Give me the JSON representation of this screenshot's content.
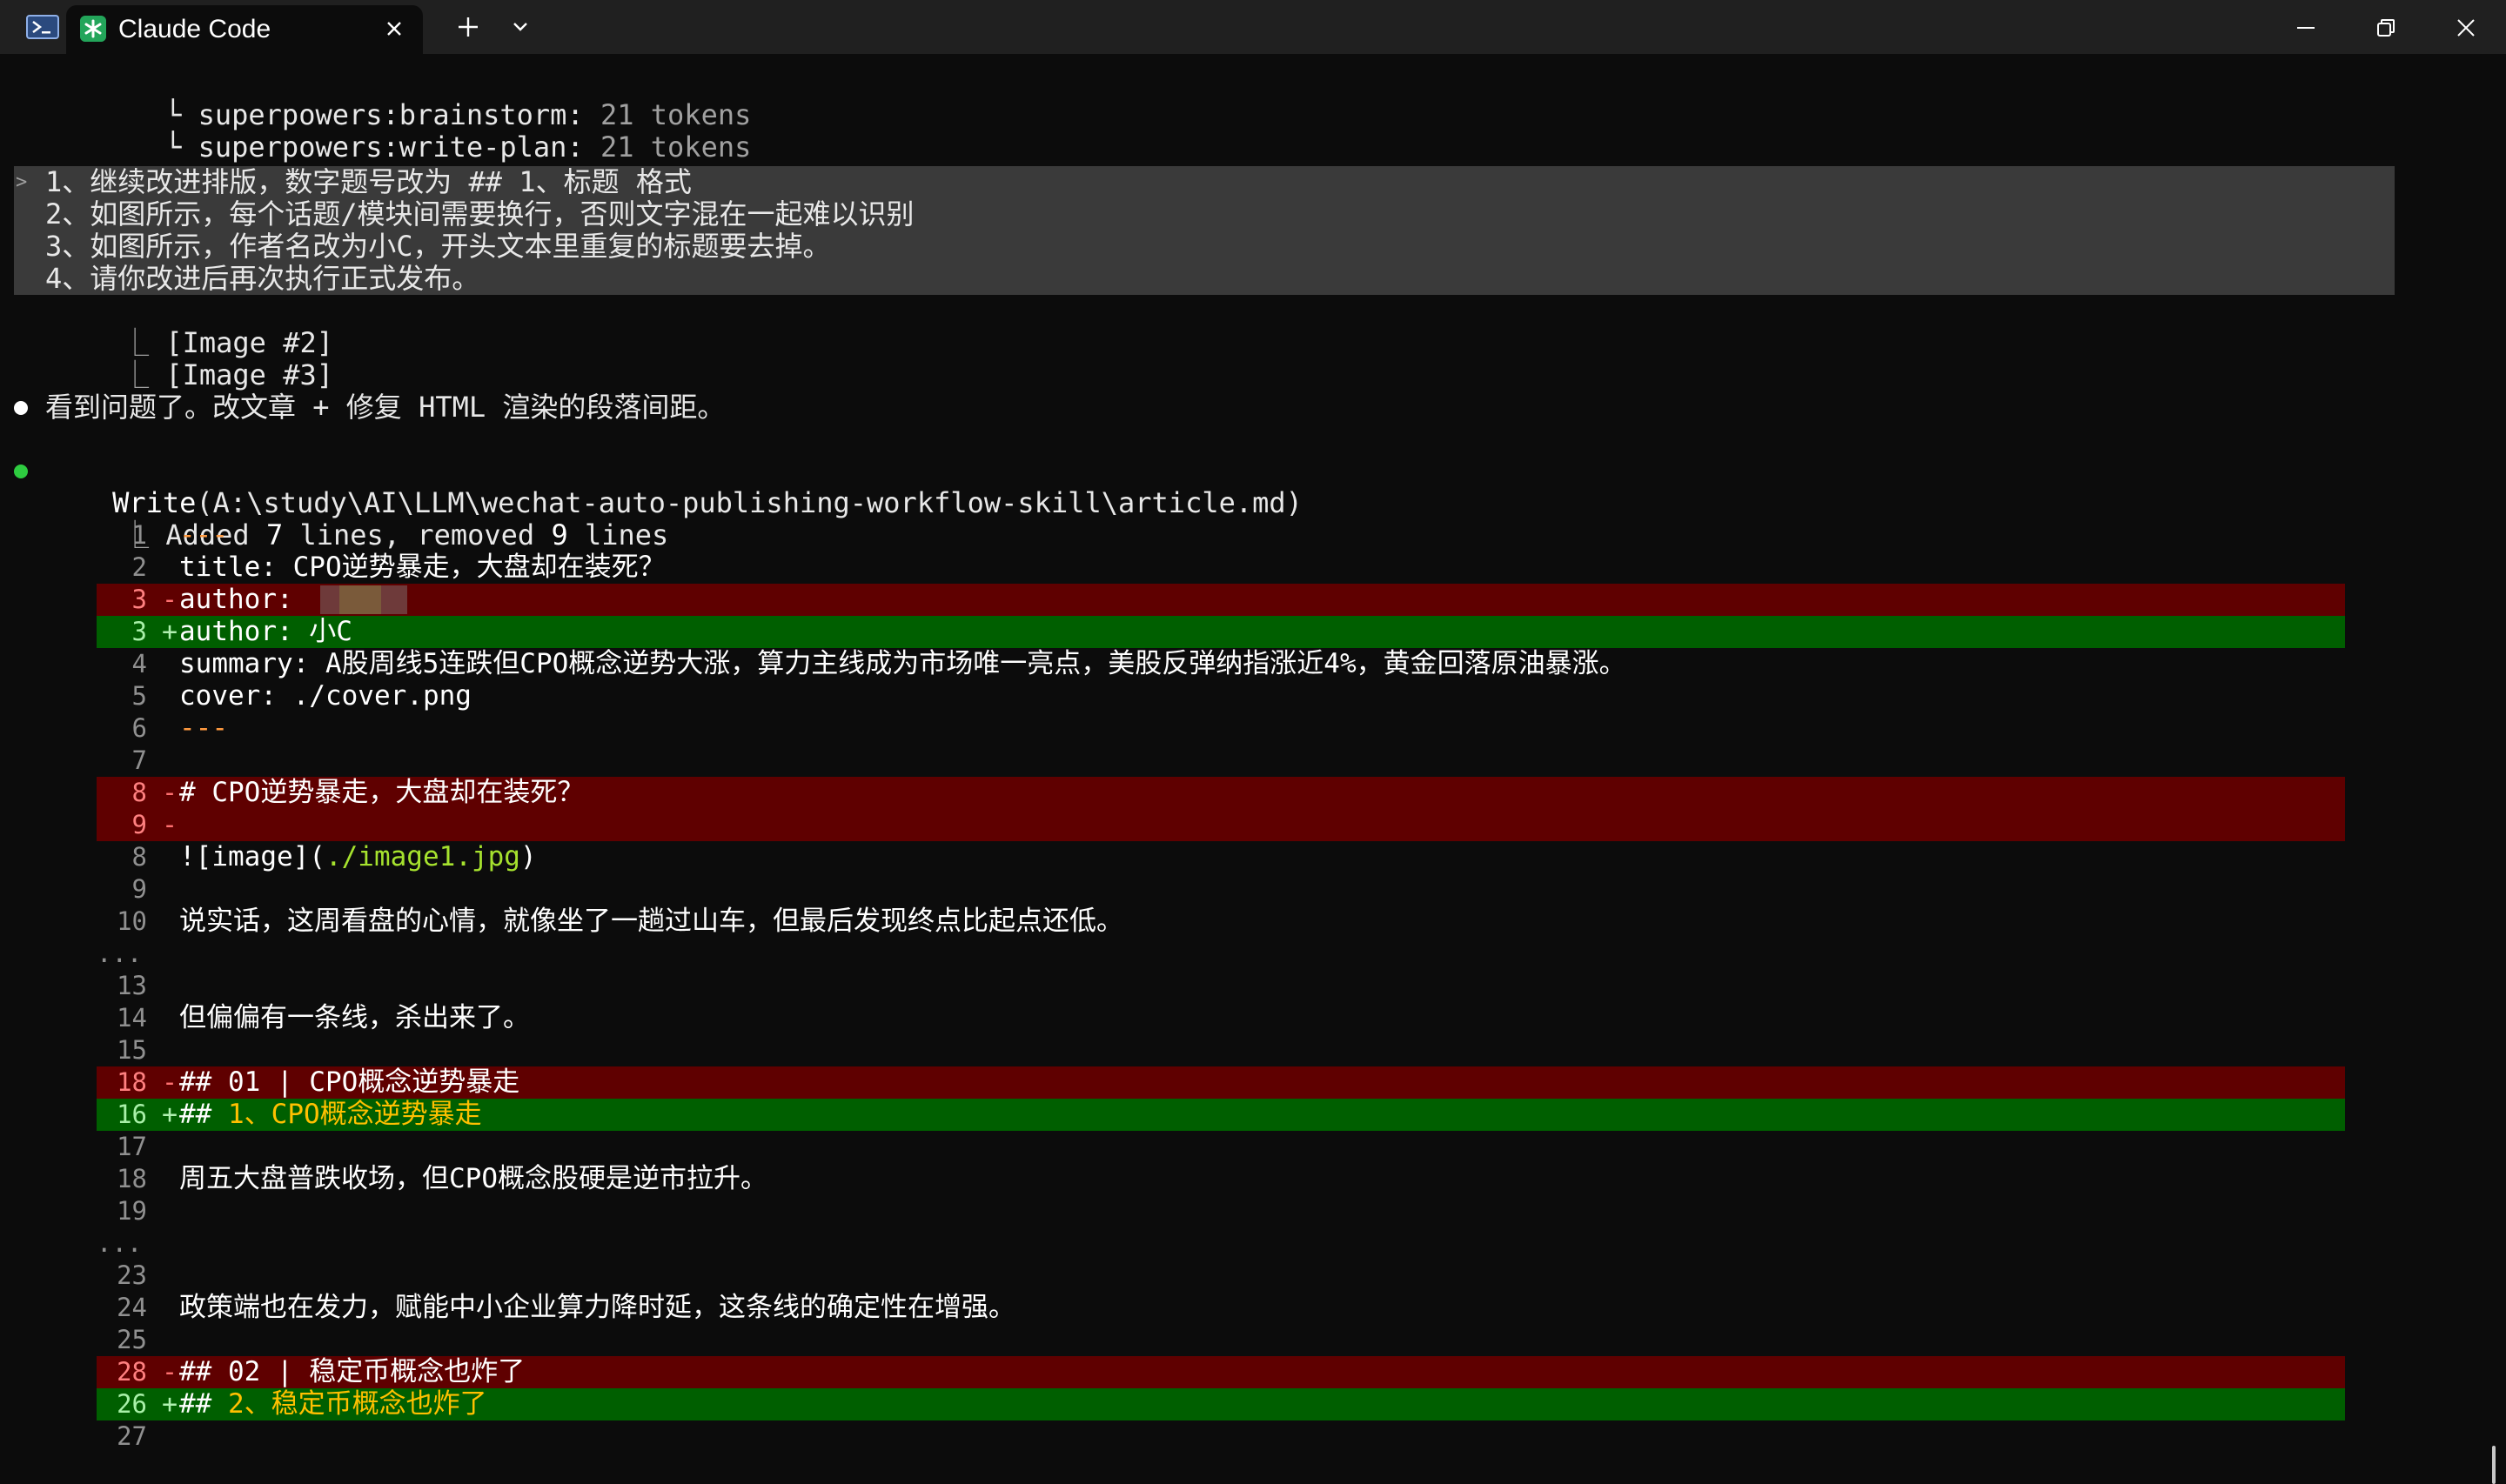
{
  "window": {
    "tab_title": "Claude Code",
    "icons": {
      "shell": "powershell-icon",
      "app": "claude-asterisk-icon"
    }
  },
  "skills": [
    {
      "prefix": "└ ",
      "name": "superpowers:brainstorm",
      "colon": ":",
      "count": "21 tokens"
    },
    {
      "prefix": "└ ",
      "name": "superpowers:write-plan",
      "colon": ":",
      "count": "21 tokens"
    }
  ],
  "prompt": {
    "caret": ">",
    "lines": [
      "1、继续改进排版，数字题号改为 ## 1、标题 格式",
      "2、如图所示，每个话题/模块间需要换行，否则文字混在一起难以识别",
      "3、如图所示，作者名改为小C，开头文本里重复的标题要去掉。",
      "4、请你改进后再次执行正式发布。"
    ],
    "attachments": [
      "[Image #2]",
      "[Image #3]"
    ]
  },
  "assistant_message": "看到问题了。改文章 + 修复 HTML 渲染的段落间距。",
  "tool_call": {
    "name": "Write",
    "path": "(A:\\study\\AI\\LLM\\wechat-auto-publishing-workflow-skill\\article.md)",
    "summary_pre": "Added ",
    "added": "7",
    "summary_mid": " lines, removed ",
    "removed": "9",
    "summary_post": " lines"
  },
  "diff": [
    {
      "num": "1",
      "sign": " ",
      "type": "ctx",
      "text": "---",
      "style": "orange"
    },
    {
      "num": "2",
      "sign": " ",
      "type": "ctx",
      "text": "title: CPO逆势暴走，大盘却在装死？"
    },
    {
      "num": "3",
      "sign": "-",
      "type": "del",
      "text": "author: "
    },
    {
      "num": "3",
      "sign": "+",
      "type": "add",
      "text": "author: 小C"
    },
    {
      "num": "4",
      "sign": " ",
      "type": "ctx",
      "text": "summary: A股周线5连跌但CPO概念逆势大涨，算力主线成为市场唯一亮点，美股反弹纳指涨近4%，黄金回落原油暴涨。"
    },
    {
      "num": "5",
      "sign": " ",
      "type": "ctx",
      "text": "cover: ./cover.png"
    },
    {
      "num": "6",
      "sign": " ",
      "type": "ctx",
      "text": "---",
      "style": "orange"
    },
    {
      "num": "7",
      "sign": " ",
      "type": "ctx",
      "text": ""
    },
    {
      "num": "8",
      "sign": "-",
      "type": "del",
      "text": "# CPO逆势暴走，大盘却在装死？"
    },
    {
      "num": "9",
      "sign": "-",
      "type": "del",
      "text": ""
    },
    {
      "num": "8",
      "sign": " ",
      "type": "ctx",
      "text": "![image](",
      "link": "./image1.jpg",
      "after": ")"
    },
    {
      "num": "9",
      "sign": " ",
      "type": "ctx",
      "text": ""
    },
    {
      "num": "10",
      "sign": " ",
      "type": "ctx",
      "text": "说实话，这周看盘的心情，就像坐了一趟过山车，但最后发现终点比起点还低。"
    },
    {
      "num": "...",
      "sign": "",
      "type": "gap",
      "text": ""
    },
    {
      "num": "13",
      "sign": " ",
      "type": "ctx",
      "text": ""
    },
    {
      "num": "14",
      "sign": " ",
      "type": "ctx",
      "text": "但偏偏有一条线，杀出来了。"
    },
    {
      "num": "15",
      "sign": " ",
      "type": "ctx",
      "text": ""
    },
    {
      "num": "18",
      "sign": "-",
      "type": "del",
      "text": "## 01 | CPO概念逆势暴走"
    },
    {
      "num": "16",
      "sign": "+",
      "type": "add",
      "text": "## ",
      "hl": "1、CPO概念逆势暴走"
    },
    {
      "num": "17",
      "sign": " ",
      "type": "ctx",
      "text": ""
    },
    {
      "num": "18",
      "sign": " ",
      "type": "ctx",
      "text": "周五大盘普跌收场，但CPO概念股硬是逆市拉升。"
    },
    {
      "num": "19",
      "sign": " ",
      "type": "ctx",
      "text": ""
    },
    {
      "num": "...",
      "sign": "",
      "type": "gap",
      "text": ""
    },
    {
      "num": "23",
      "sign": " ",
      "type": "ctx",
      "text": ""
    },
    {
      "num": "24",
      "sign": " ",
      "type": "ctx",
      "text": "政策端也在发力，赋能中小企业算力降时延，这条线的确定性在增强。"
    },
    {
      "num": "25",
      "sign": " ",
      "type": "ctx",
      "text": ""
    },
    {
      "num": "28",
      "sign": "-",
      "type": "del",
      "text": "## 02 | 稳定币概念也炸了"
    },
    {
      "num": "26",
      "sign": "+",
      "type": "add",
      "text": "## ",
      "hl": "2、稳定币概念也炸了"
    },
    {
      "num": "27",
      "sign": " ",
      "type": "ctx",
      "text": ""
    }
  ],
  "colors": {
    "terminal_bg": "#0c0c0c",
    "titlebar_bg": "#202020",
    "deleted_bg": "#5f0000",
    "added_bg": "#005f00",
    "prompt_bg": "#3a3a3a",
    "bullet_white": "#ffffff",
    "bullet_green": "#2ecc40"
  }
}
